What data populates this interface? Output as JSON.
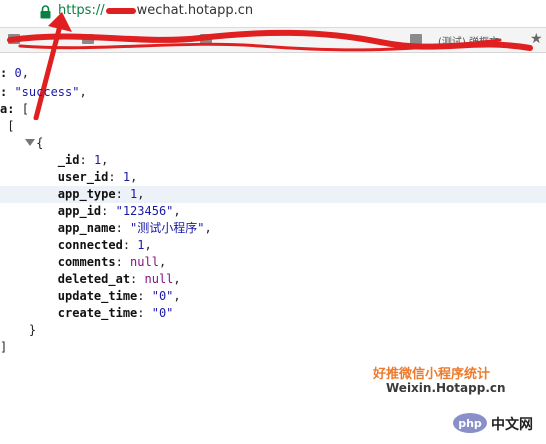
{
  "address_bar": {
    "scheme": "https://",
    "host_visible": "wechat.hotapp.cn"
  },
  "bookmarks": {
    "visible_text": "(测试) 弹框文"
  },
  "json": {
    "lines": [
      {
        "pre": "",
        "key": ": ",
        "value": "0",
        "vtype": "n",
        "post": ","
      },
      {
        "pre": "",
        "key": ": ",
        "value": "\"success\"",
        "vtype": "s",
        "post": ","
      },
      {
        "pre": "",
        "key": "a: ",
        "value": "",
        "vtype": "p",
        "post": "["
      },
      {
        "pre": " ",
        "key": "",
        "value": "",
        "vtype": "p",
        "post": "["
      },
      {
        "pre": "     ",
        "key": "",
        "value": "",
        "vtype": "p",
        "post": "{"
      },
      {
        "pre": "        ",
        "key": "_id",
        "value": "1",
        "vtype": "n",
        "post": ","
      },
      {
        "pre": "        ",
        "key": "user_id",
        "value": "1",
        "vtype": "n",
        "post": ","
      },
      {
        "pre": "        ",
        "key": "app_type",
        "value": "1",
        "vtype": "n",
        "post": ","
      },
      {
        "pre": "        ",
        "key": "app_id",
        "value": "\"123456\"",
        "vtype": "s",
        "post": ","
      },
      {
        "pre": "        ",
        "key": "app_name",
        "value": "\"测试小程序\"",
        "vtype": "s",
        "post": ","
      },
      {
        "pre": "        ",
        "key": "connected",
        "value": "1",
        "vtype": "n",
        "post": ","
      },
      {
        "pre": "        ",
        "key": "comments",
        "value": "null",
        "vtype": "nl",
        "post": ","
      },
      {
        "pre": "        ",
        "key": "deleted_at",
        "value": "null",
        "vtype": "nl",
        "post": ","
      },
      {
        "pre": "        ",
        "key": "update_time",
        "value": "\"0\"",
        "vtype": "s",
        "post": ","
      },
      {
        "pre": "        ",
        "key": "create_time",
        "value": "\"0\"",
        "vtype": "s",
        "post": ""
      },
      {
        "pre": "    ",
        "key": "",
        "value": "",
        "vtype": "p",
        "post": "}"
      },
      {
        "pre": "",
        "key": "",
        "value": "",
        "vtype": "p",
        "post": "]"
      }
    ]
  },
  "watermark": {
    "line1": "好推微信小程序统计",
    "line2": "Weixin.Hotapp.cn"
  },
  "php_watermark": {
    "logo_text": "php",
    "label": "中文网"
  },
  "colors": {
    "secure_green": "#0b8043",
    "annotation_red": "#e02020",
    "watermark_orange": "#ec7b2f",
    "json_number": "#1a1aa6",
    "json_null": "#881280"
  }
}
